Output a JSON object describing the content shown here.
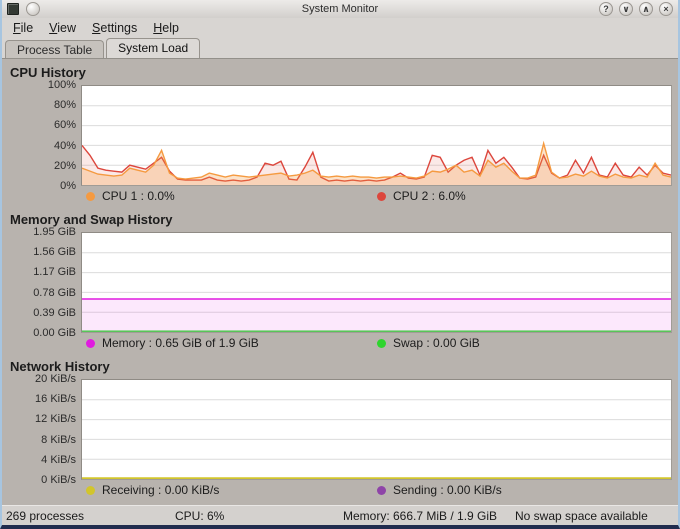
{
  "window": {
    "title": "System Monitor",
    "buttons": {
      "help": "?",
      "shade": "∨",
      "maximize": "∧",
      "close": "×"
    }
  },
  "menubar": {
    "items": [
      {
        "label": "File"
      },
      {
        "label": "View"
      },
      {
        "label": "Settings"
      },
      {
        "label": "Help"
      }
    ]
  },
  "tabs": [
    {
      "label": "Process Table",
      "active": false
    },
    {
      "label": "System Load",
      "active": true
    }
  ],
  "charts": [
    {
      "type": "area",
      "title": "CPU History",
      "ymin": 0,
      "ymax": 100,
      "yticks": [
        "100%",
        "80%",
        "60%",
        "40%",
        "20%",
        "0%"
      ],
      "grid": true,
      "series": [
        {
          "name": "CPU 1",
          "legend": "CPU 1 : 0.0%",
          "color": "#f59a40",
          "fill": "rgba(245,154,64,0.28)",
          "values": [
            17,
            14,
            11,
            10,
            9,
            10,
            17,
            15,
            13,
            20,
            35,
            12,
            7,
            6,
            7,
            8,
            12,
            10,
            8,
            10,
            9,
            8,
            9,
            10,
            11,
            12,
            9,
            10,
            12,
            15,
            9,
            8,
            9,
            8,
            9,
            8,
            8,
            7,
            8,
            8,
            9,
            8,
            7,
            9,
            14,
            13,
            16,
            20,
            13,
            15,
            9,
            25,
            18,
            22,
            14,
            7,
            7,
            10,
            42,
            13,
            7,
            8,
            11,
            9,
            14,
            9,
            7,
            11,
            8,
            7,
            10,
            8,
            22,
            10,
            8
          ]
        },
        {
          "name": "CPU 2",
          "legend": "CPU 2 : 6.0%",
          "color": "#dc463c",
          "fill": "rgba(220,70,60,0.12)",
          "values": [
            40,
            30,
            17,
            15,
            14,
            13,
            20,
            18,
            16,
            22,
            28,
            14,
            6,
            5,
            5,
            5,
            8,
            5,
            4,
            5,
            4,
            5,
            8,
            22,
            20,
            24,
            6,
            5,
            18,
            33,
            8,
            4,
            5,
            4,
            5,
            4,
            5,
            4,
            5,
            8,
            12,
            7,
            6,
            8,
            30,
            28,
            13,
            20,
            25,
            28,
            10,
            35,
            22,
            28,
            18,
            7,
            6,
            8,
            30,
            12,
            7,
            10,
            25,
            12,
            28,
            10,
            8,
            22,
            10,
            8,
            18,
            10,
            20,
            12,
            10
          ]
        }
      ]
    },
    {
      "type": "area",
      "title": "Memory and Swap History",
      "ymin": 0,
      "ymax": 1.95,
      "yticks": [
        "1.95 GiB",
        "1.56 GiB",
        "1.17 GiB",
        "0.78 GiB",
        "0.39 GiB",
        "0.00 GiB"
      ],
      "grid": true,
      "series": [
        {
          "name": "Memory",
          "legend": "Memory : 0.65 GiB of 1.9 GiB",
          "color": "#e01ce0",
          "fill": "rgba(224,28,224,0.10)",
          "values": [
            0.65,
            0.65
          ]
        },
        {
          "name": "Swap",
          "legend": "Swap : 0.00 GiB",
          "color": "#2ed52e",
          "fill": null,
          "values": [
            0,
            0
          ]
        }
      ]
    },
    {
      "type": "line",
      "title": "Network History",
      "ymin": 0,
      "ymax": 20,
      "yticks": [
        "20 KiB/s",
        "16 KiB/s",
        "12 KiB/s",
        "8 KiB/s",
        "4 KiB/s",
        "0 KiB/s"
      ],
      "grid": true,
      "series": [
        {
          "name": "Receiving",
          "legend": "Receiving : 0.00 KiB/s",
          "color": "#d2c52c",
          "fill": null,
          "values": [
            0,
            0
          ],
          "width": 2
        },
        {
          "name": "Sending",
          "legend": "Sending : 0.00 KiB/s",
          "color": "#8e44a8",
          "fill": null,
          "values": [
            0,
            0
          ]
        }
      ]
    }
  ],
  "statusbar": {
    "processes": "269 processes",
    "cpu": "CPU: 6%",
    "memory": "Memory: 666.7 MiB / 1.9 GiB",
    "swap": "No swap space available"
  }
}
